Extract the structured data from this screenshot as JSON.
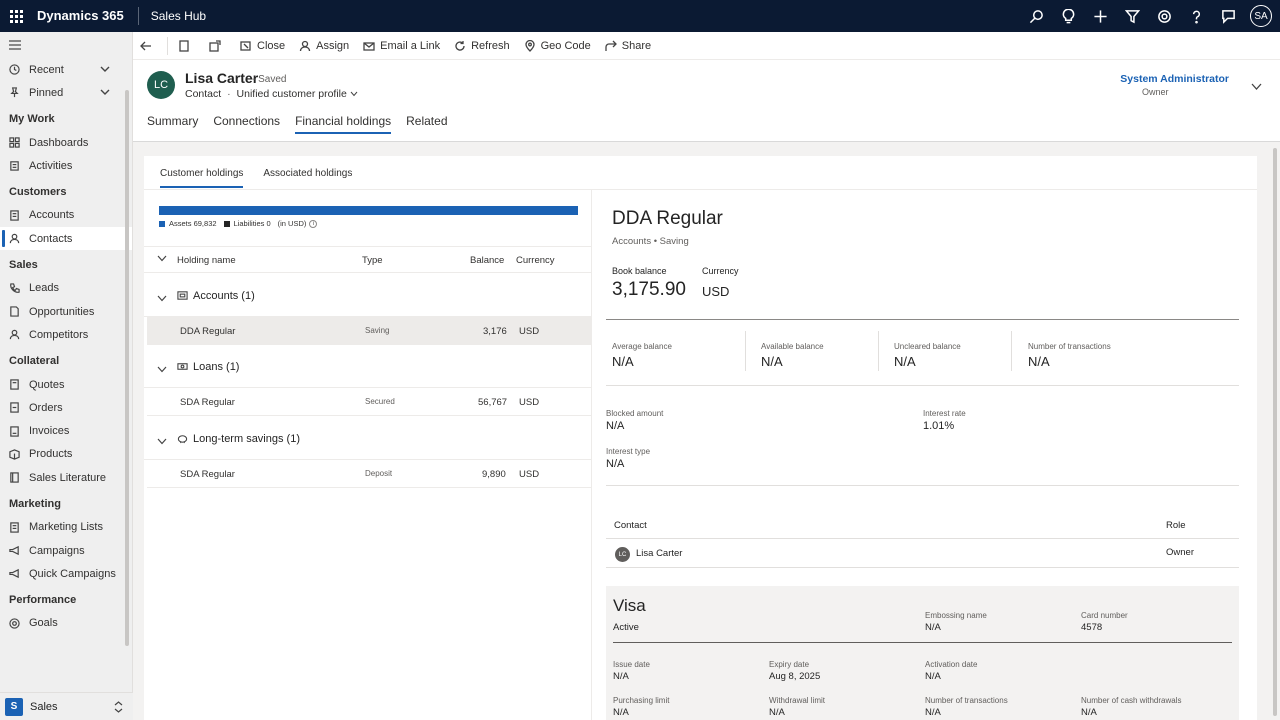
{
  "topbar": {
    "brand": "Dynamics 365",
    "app_name": "Sales Hub",
    "user_initials": "SA",
    "icons": [
      "search-icon",
      "lightbulb-icon",
      "plus-icon",
      "filter-icon",
      "settings-icon",
      "help-icon",
      "chat-icon"
    ]
  },
  "sidebar": {
    "recent": "Recent",
    "pinned": "Pinned",
    "groups": {
      "my_work": "My Work",
      "customers": "Customers",
      "sales": "Sales",
      "collateral": "Collateral",
      "marketing": "Marketing",
      "performance": "Performance"
    },
    "items": {
      "dashboards": "Dashboards",
      "activities": "Activities",
      "accounts": "Accounts",
      "contacts": "Contacts",
      "leads": "Leads",
      "opportunities": "Opportunities",
      "competitors": "Competitors",
      "quotes": "Quotes",
      "orders": "Orders",
      "invoices": "Invoices",
      "products": "Products",
      "sales_literature": "Sales Literature",
      "marketing_lists": "Marketing Lists",
      "campaigns": "Campaigns",
      "quick_campaigns": "Quick Campaigns",
      "goals": "Goals"
    },
    "area": {
      "badge": "S",
      "label": "Sales"
    }
  },
  "commands": {
    "close": "Close",
    "assign": "Assign",
    "email_link": "Email a Link",
    "refresh": "Refresh",
    "geo_code": "Geo Code",
    "share": "Share"
  },
  "record": {
    "initials": "LC",
    "name": "Lisa Carter",
    "status": "- Saved",
    "entity": "Contact",
    "form": "Unified customer profile",
    "owner_name": "System Administrator",
    "owner_label": "Owner",
    "tabs": [
      "Summary",
      "Connections",
      "Financial holdings",
      "Related"
    ]
  },
  "holdings": {
    "subtabs": [
      "Customer holdings",
      "Associated holdings"
    ],
    "legend": {
      "assets": "Assets 69,832",
      "liabilities": "Liabilities 0",
      "unit": "(in USD)"
    },
    "bar": {
      "assets": 69832,
      "liabilities": 0
    },
    "columns": {
      "name": "Holding name",
      "type": "Type",
      "balance": "Balance",
      "currency": "Currency"
    },
    "groups": [
      {
        "name": "Accounts (1)",
        "rows": [
          {
            "name": "DDA Regular",
            "type": "Saving",
            "balance": "3,176",
            "currency": "USD"
          }
        ]
      },
      {
        "name": "Loans (1)",
        "rows": [
          {
            "name": "SDA Regular",
            "type": "Secured",
            "balance": "56,767",
            "currency": "USD"
          }
        ]
      },
      {
        "name": "Long-term savings (1)",
        "rows": [
          {
            "name": "SDA Regular",
            "type": "Deposit",
            "balance": "9,890",
            "currency": "USD"
          }
        ]
      }
    ]
  },
  "detail": {
    "title": "DDA Regular",
    "subtitle": "Accounts • Saving",
    "book_balance_label": "Book balance",
    "book_balance": "3,175.90",
    "currency_label": "Currency",
    "currency": "USD",
    "stats": [
      {
        "label": "Average balance",
        "value": "N/A"
      },
      {
        "label": "Available balance",
        "value": "N/A"
      },
      {
        "label": "Uncleared balance",
        "value": "N/A"
      },
      {
        "label": "Number of transactions",
        "value": "N/A"
      }
    ],
    "blocked_amount_label": "Blocked amount",
    "blocked_amount": "N/A",
    "interest_rate_label": "Interest rate",
    "interest_rate": "1.01%",
    "interest_type_label": "Interest type",
    "interest_type": "N/A",
    "contact_header": "Contact",
    "role_header": "Role",
    "contact_initials": "LC",
    "contact_name": "Lisa Carter",
    "contact_role": "Owner",
    "card": {
      "title": "Visa",
      "status": "Active",
      "embossing_name_label": "Embossing name",
      "embossing_name": "N/A",
      "card_number_label": "Card number",
      "card_number": "4578",
      "issue_date_label": "Issue date",
      "issue_date": "N/A",
      "expiry_date_label": "Expiry date",
      "expiry_date": "Aug 8, 2025",
      "activation_date_label": "Activation date",
      "activation_date": "N/A",
      "purchasing_limit_label": "Purchasing limit",
      "purchasing_limit": "N/A",
      "withdrawal_limit_label": "Withdrawal limit",
      "withdrawal_limit": "N/A",
      "num_transactions_label": "Number of transactions",
      "num_transactions": "N/A",
      "num_cash_withdrawals_label": "Number of cash withdrawals",
      "num_cash_withdrawals": "N/A"
    }
  },
  "colors": {
    "topbar": "#0b1a33",
    "accent": "#1b62b4",
    "assets": "#1b62b4",
    "liabilities": "#242424",
    "avatar": "#1f5e4f"
  }
}
